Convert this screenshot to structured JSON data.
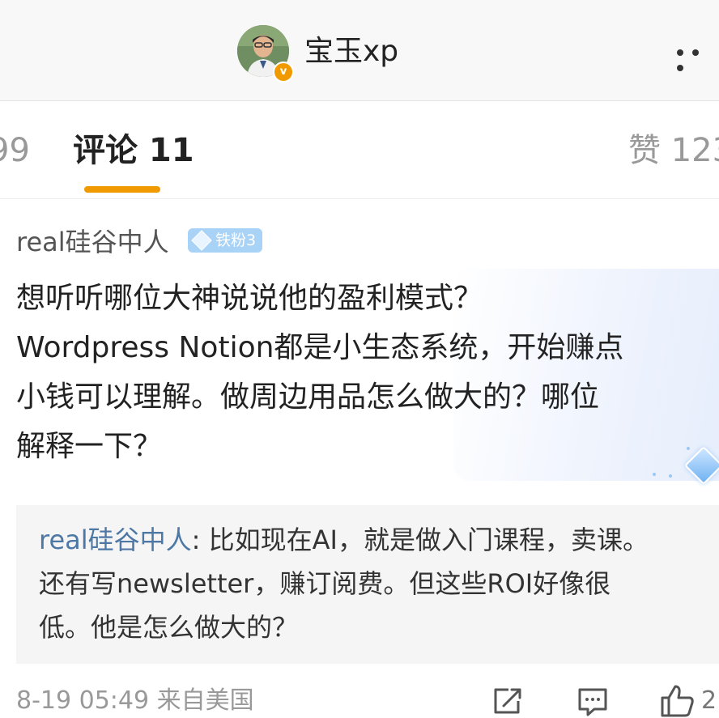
{
  "header": {
    "user_name": "宝玉xp",
    "verified_badge": "v"
  },
  "tabs": {
    "left_partial": "99",
    "comments_label": "评论 11",
    "likes_label": "赞 123"
  },
  "comment": {
    "author": "real硅谷中人",
    "fan_badge": "铁粉3",
    "lines": [
      "想听听哪位大神说说他的盈利模式？",
      "Wordpress Notion都是小生态系统，开始赚点",
      "小钱可以理解。做周边用品怎么做大的？哪位",
      "解释一下？"
    ],
    "reply": {
      "author": "real硅谷中人",
      "separator": ": ",
      "line1": "比如现在AI，就是做入门课程，卖课。",
      "line2": "还有写newsletter，赚订阅费。但这些ROI好像很",
      "line3": "低。他是怎么做大的？"
    },
    "timestamp": "8-19 05:49  来自美国",
    "like_count": "2"
  },
  "icons": {
    "more": "more-dots-icon",
    "share": "share-icon",
    "reply": "comment-icon",
    "like": "thumbs-up-icon",
    "fan": "diamond-icon"
  },
  "colors": {
    "accent": "#f19a00",
    "reply_author": "#4d78a6",
    "fan_badge": "#a9d2f7"
  }
}
